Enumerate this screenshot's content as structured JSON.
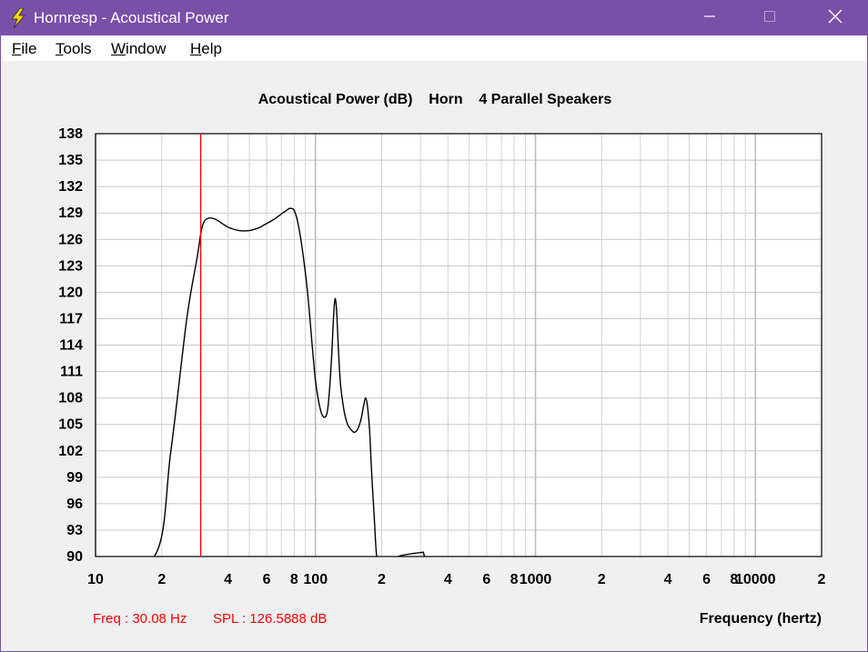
{
  "window": {
    "title": "Hornresp - Acoustical Power",
    "icon": "lightning-icon",
    "controls": [
      "minimize-icon",
      "maximize-icon",
      "close-icon"
    ]
  },
  "menu": {
    "items": [
      {
        "label": "File",
        "accel": "F",
        "rest": "ile"
      },
      {
        "label": "Tools",
        "accel": "T",
        "rest": "ools"
      },
      {
        "label": "Window",
        "accel": "W",
        "rest": "indow"
      },
      {
        "label": "Help",
        "accel": "H",
        "rest": "elp"
      }
    ]
  },
  "status": {
    "freq": "Freq : 30.08 Hz",
    "spl": "SPL : 126.5888 dB"
  },
  "colors": {
    "titlebar": "#7a4fa8",
    "cursor": "#ff0000",
    "curve": "#000000",
    "grid": "#c8c8c8",
    "status_text": "#ff0000"
  },
  "chart_data": {
    "type": "line",
    "title": "Acoustical Power (dB)    Horn    4 Parallel Speakers",
    "xlabel": "Frequency (hertz)",
    "ylabel": "",
    "x_scale": "log",
    "xlim": [
      10,
      20000
    ],
    "ylim": [
      90,
      138
    ],
    "y_ticks": [
      138,
      135,
      132,
      129,
      126,
      123,
      120,
      117,
      114,
      111,
      108,
      105,
      102,
      99,
      96,
      93,
      90
    ],
    "x_tick_labels": [
      {
        "f": 10,
        "label": "10"
      },
      {
        "f": 20,
        "label": "2"
      },
      {
        "f": 40,
        "label": "4"
      },
      {
        "f": 60,
        "label": "6"
      },
      {
        "f": 80,
        "label": "8"
      },
      {
        "f": 100,
        "label": "100"
      },
      {
        "f": 200,
        "label": "2"
      },
      {
        "f": 400,
        "label": "4"
      },
      {
        "f": 600,
        "label": "6"
      },
      {
        "f": 800,
        "label": "8"
      },
      {
        "f": 1000,
        "label": "1000"
      },
      {
        "f": 2000,
        "label": "2"
      },
      {
        "f": 4000,
        "label": "4"
      },
      {
        "f": 6000,
        "label": "6"
      },
      {
        "f": 8000,
        "label": "8"
      },
      {
        "f": 10000,
        "label": "10000"
      },
      {
        "f": 20000,
        "label": "2"
      }
    ],
    "cursor_freq": 30.08,
    "cursor_spl": 126.5888,
    "series": [
      {
        "x": [
          10,
          18.5,
          22,
          26,
          29,
          30.08,
          31,
          32.5,
          35,
          40,
          45,
          50,
          55,
          60,
          65,
          70,
          73,
          76,
          78,
          80,
          83,
          87,
          92,
          97,
          100,
          105,
          110,
          114,
          118,
          121,
          123,
          125,
          127,
          130,
          135,
          140,
          145,
          150,
          155,
          160,
          163,
          166,
          169,
          172,
          176,
          180,
          185,
          190,
          200,
          300,
          310,
          320,
          20000
        ],
        "y": [
          89,
          90,
          102,
          117,
          124,
          126.6,
          127.9,
          128.4,
          128.3,
          127.4,
          127.0,
          127.0,
          127.3,
          127.8,
          128.3,
          128.9,
          129.2,
          129.5,
          129.5,
          129.3,
          128,
          125,
          120,
          113.5,
          110,
          106.8,
          105.8,
          107,
          112,
          117.5,
          119.3,
          117.5,
          113.8,
          109.5,
          106.5,
          105,
          104.4,
          104.1,
          104.4,
          105.3,
          106.2,
          107.3,
          108,
          107.2,
          104.5,
          99.5,
          94.5,
          90,
          89,
          89.5,
          90.5,
          89.5,
          89
        ]
      }
    ]
  }
}
